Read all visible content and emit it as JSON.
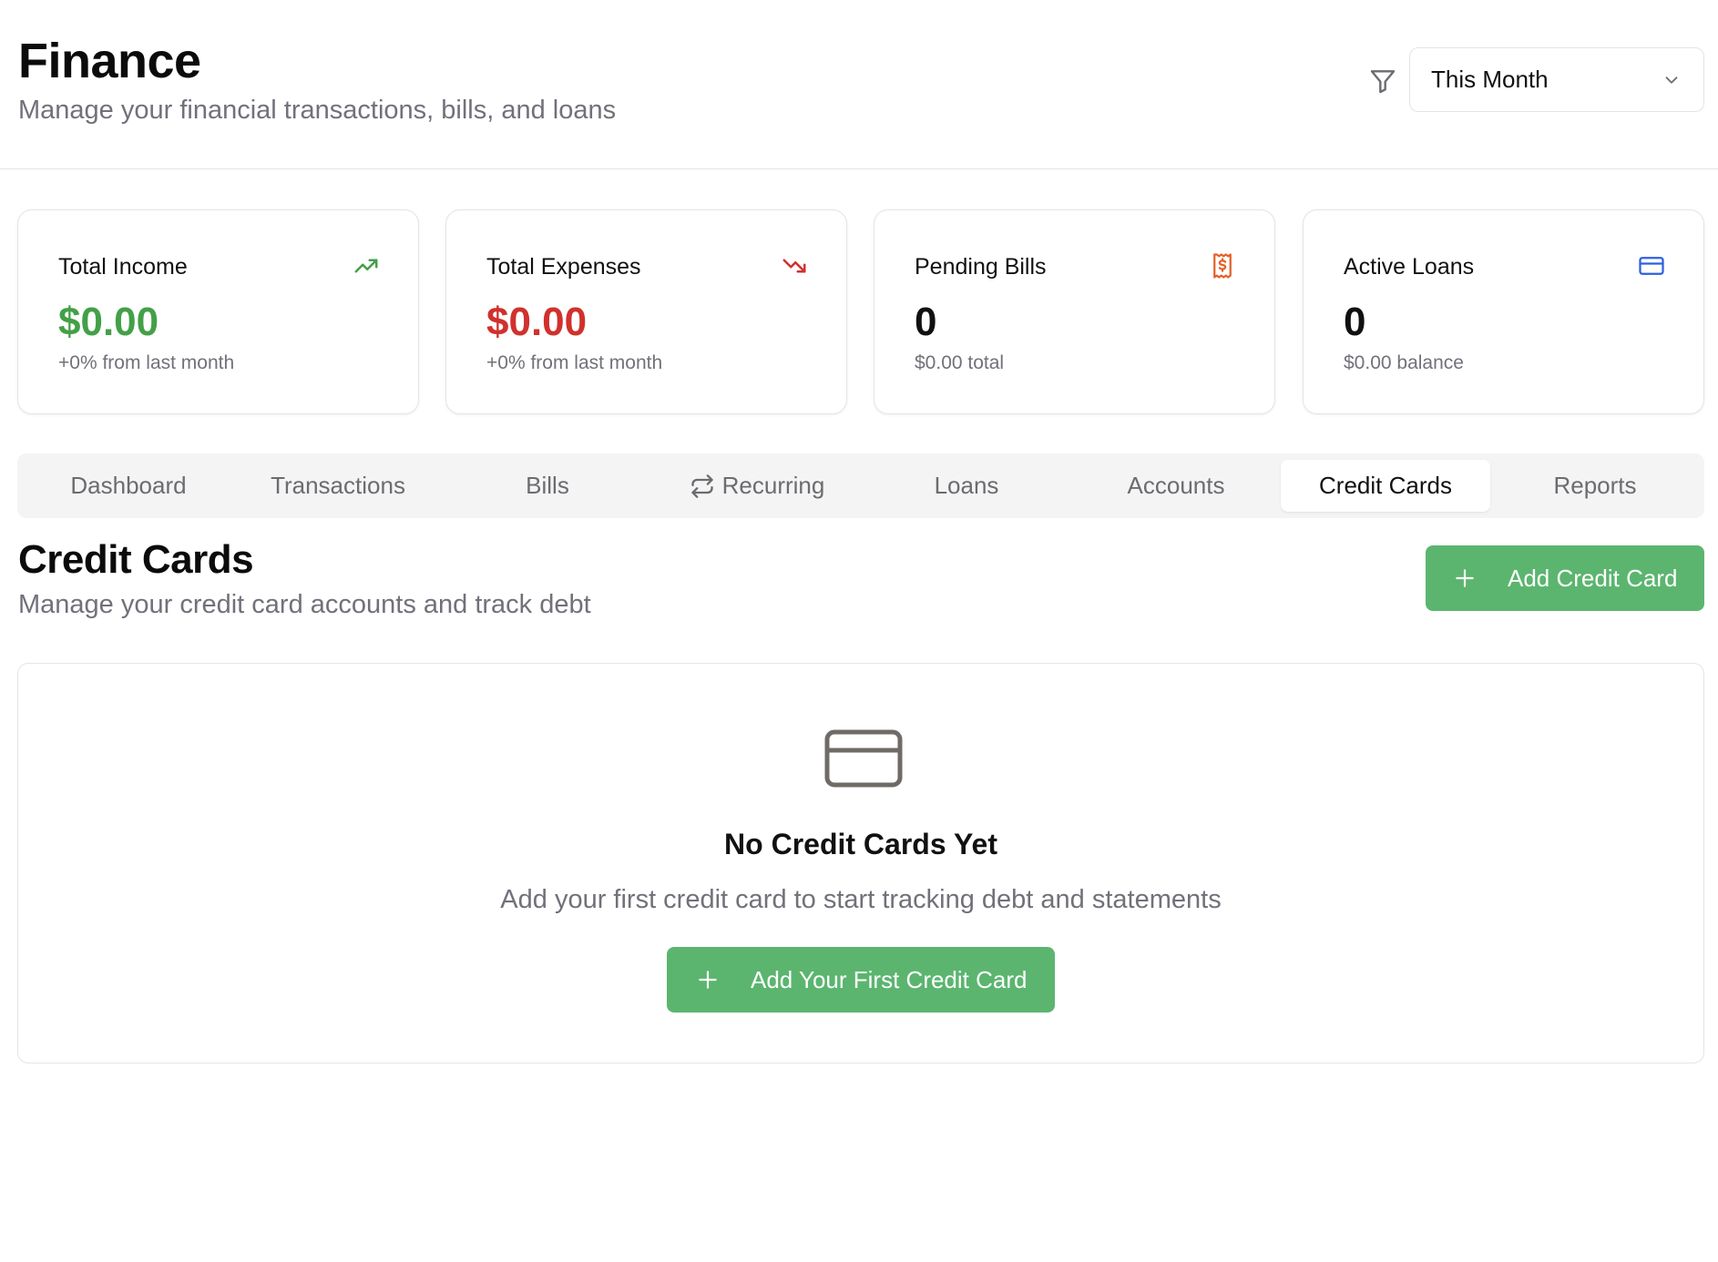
{
  "header": {
    "title": "Finance",
    "subtitle": "Manage your financial transactions, bills, and loans",
    "period_select": {
      "value": "This Month"
    }
  },
  "stats": [
    {
      "label": "Total Income",
      "value": "$0.00",
      "note": "+0% from last month",
      "icon": "trending-up-icon",
      "color": "#43a047"
    },
    {
      "label": "Total Expenses",
      "value": "$0.00",
      "note": "+0% from last month",
      "icon": "trending-down-icon",
      "color": "#d0312d"
    },
    {
      "label": "Pending Bills",
      "value": "0",
      "note": "$0.00 total",
      "icon": "receipt-icon",
      "color": "#e2622a"
    },
    {
      "label": "Active Loans",
      "value": "0",
      "note": "$0.00 balance",
      "icon": "credit-card-icon",
      "color": "#2f5fe0"
    }
  ],
  "tabs": [
    {
      "label": "Dashboard"
    },
    {
      "label": "Transactions"
    },
    {
      "label": "Bills"
    },
    {
      "label": "Recurring",
      "icon": "repeat-icon"
    },
    {
      "label": "Loans"
    },
    {
      "label": "Accounts"
    },
    {
      "label": "Credit Cards",
      "active": true
    },
    {
      "label": "Reports"
    }
  ],
  "section": {
    "title": "Credit Cards",
    "subtitle": "Manage your credit card accounts and track debt",
    "add_button": "Add Credit Card"
  },
  "empty_state": {
    "icon": "credit-card-icon",
    "title": "No Credit Cards Yet",
    "text": "Add your first credit card to start tracking debt and statements",
    "button": "Add Your First Credit Card"
  },
  "colors": {
    "accent_green": "#5bb56f",
    "income_green": "#43a047",
    "expense_red": "#d0312d"
  }
}
